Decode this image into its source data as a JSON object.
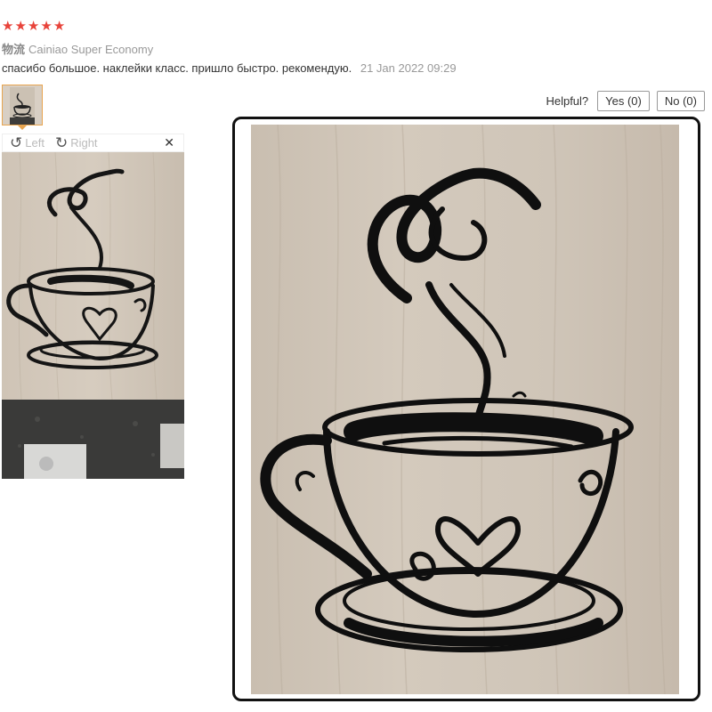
{
  "review": {
    "rating": 5,
    "stars": [
      "★",
      "★",
      "★",
      "★",
      "★"
    ],
    "logistics_label": "物流",
    "logistics_value": "Cainiao Super Economy",
    "text": "спасибо большое. наклейки класс. пришло быстро. рекомендую.",
    "date": "21 Jan 2022 09:29"
  },
  "helpful": {
    "question": "Helpful?",
    "yes_label": "Yes (0)",
    "no_label": "No (0)"
  },
  "viewer": {
    "left_label": "Left",
    "right_label": "Right",
    "close_glyph": "✕"
  },
  "colors": {
    "star": "#e8433a",
    "thumb_border": "#e8a550",
    "wood": "#cdc3b6",
    "decal": "#111111"
  }
}
